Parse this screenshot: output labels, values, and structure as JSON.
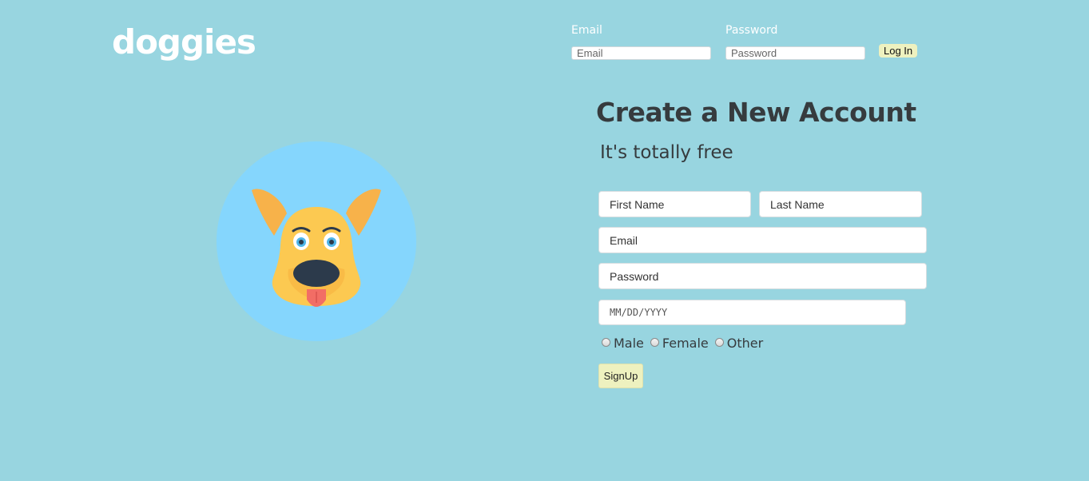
{
  "header": {
    "logo": "doggies",
    "login": {
      "email_label": "Email",
      "email_placeholder": "Email",
      "password_label": "Password",
      "password_placeholder": "Password",
      "button_label": "Log In"
    }
  },
  "hero": {
    "image_icon": "dog-face-icon"
  },
  "signup": {
    "title": "Create a New Account",
    "subtitle": "It's totally free",
    "first_name_placeholder": "First Name",
    "last_name_placeholder": "Last Name",
    "email_placeholder": "Email",
    "password_placeholder": "Password",
    "birthday_placeholder": "MM/DD/YYYY",
    "gender_options": [
      "Male",
      "Female",
      "Other"
    ],
    "button_label": "SignUp"
  },
  "colors": {
    "background": "#98d5e0",
    "hero_circle": "#85d6fd",
    "button": "#eef1bf",
    "heading_text": "#363b3e"
  }
}
